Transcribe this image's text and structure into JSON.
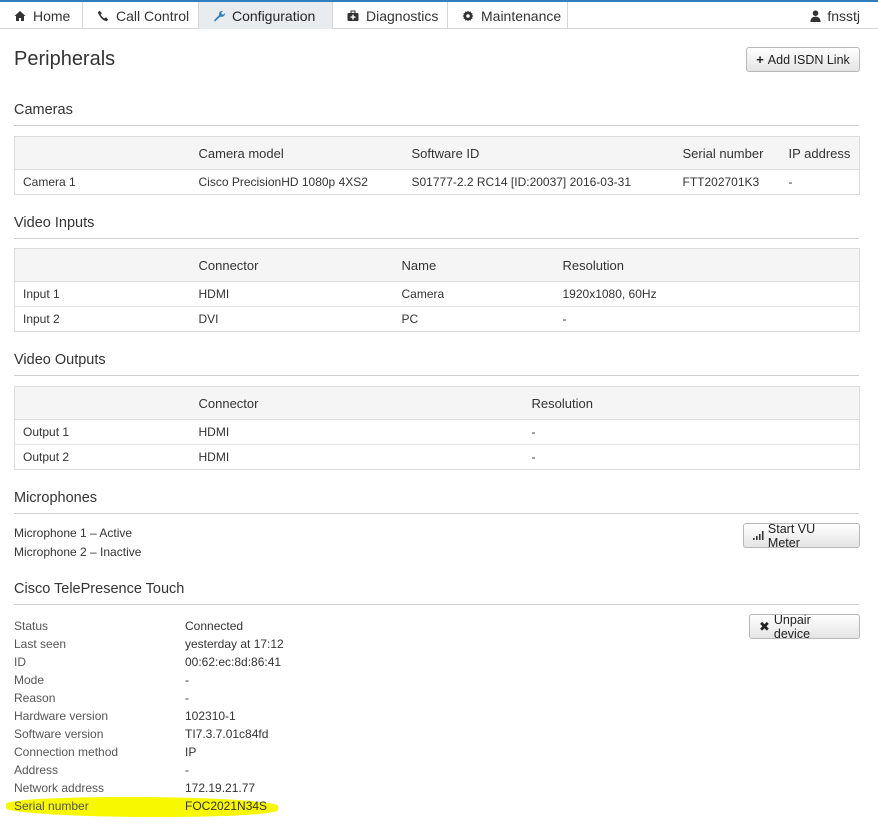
{
  "nav": {
    "tabs": [
      {
        "label": "Home",
        "icon": "home-icon"
      },
      {
        "label": "Call Control",
        "icon": "phone-icon"
      },
      {
        "label": "Configuration",
        "icon": "wrench-icon"
      },
      {
        "label": "Diagnostics",
        "icon": "medkit-icon"
      },
      {
        "label": "Maintenance",
        "icon": "gear-icon"
      }
    ],
    "active_tab": "Configuration",
    "user": "fnsstj"
  },
  "page": {
    "title": "Peripherals",
    "add_isdn_label": "Add ISDN Link"
  },
  "cameras": {
    "title": "Cameras",
    "headers": [
      "",
      "Camera model",
      "Software ID",
      "Serial number",
      "IP address"
    ],
    "rows": [
      [
        "Camera 1",
        "Cisco PrecisionHD 1080p 4XS2",
        "S01777-2.2 RC14 [ID:20037] 2016-03-31",
        "FTT202701K3",
        "-"
      ]
    ]
  },
  "video_inputs": {
    "title": "Video Inputs",
    "headers": [
      "",
      "Connector",
      "Name",
      "Resolution"
    ],
    "rows": [
      [
        "Input 1",
        "HDMI",
        "Camera",
        "1920x1080, 60Hz"
      ],
      [
        "Input 2",
        "DVI",
        "PC",
        "-"
      ]
    ]
  },
  "video_outputs": {
    "title": "Video Outputs",
    "headers": [
      "",
      "Connector",
      "Resolution"
    ],
    "rows": [
      [
        "Output 1",
        "HDMI",
        "-"
      ],
      [
        "Output 2",
        "HDMI",
        "-"
      ]
    ]
  },
  "microphones": {
    "title": "Microphones",
    "items": [
      "Microphone 1 – Active",
      "Microphone 2 – Inactive"
    ],
    "vu_button_label": "Start VU Meter"
  },
  "touch": {
    "title": "Cisco TelePresence Touch",
    "unpair_label": "Unpair device",
    "fields": [
      {
        "label": "Status",
        "value": "Connected"
      },
      {
        "label": "Last seen",
        "value": "yesterday at 17:12"
      },
      {
        "label": "ID",
        "value": "00:62:ec:8d:86:41"
      },
      {
        "label": "Mode",
        "value": "-"
      },
      {
        "label": "Reason",
        "value": "-"
      },
      {
        "label": "Hardware version",
        "value": "102310-1"
      },
      {
        "label": "Software version",
        "value": "TI7.3.7.01c84fd"
      },
      {
        "label": "Connection method",
        "value": "IP"
      },
      {
        "label": "Address",
        "value": "-"
      },
      {
        "label": "Network address",
        "value": "172.19.21.77"
      },
      {
        "label": "Serial number",
        "value": "FOC2021N34S"
      }
    ]
  },
  "colors": {
    "nav_accent": "#2f7ec0",
    "highlight": "#f8f800"
  }
}
